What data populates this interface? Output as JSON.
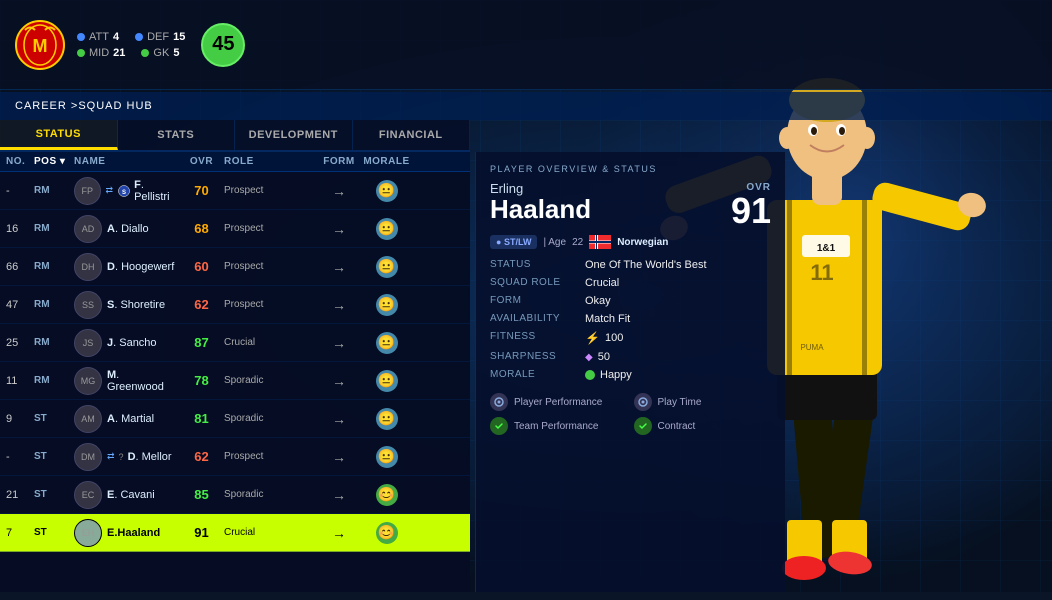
{
  "header": {
    "club": "Manchester United",
    "stats": {
      "att": {
        "label": "ATT",
        "value": "4",
        "color": "blue"
      },
      "def": {
        "label": "DEF",
        "value": "15",
        "color": "blue"
      },
      "mid": {
        "label": "MID",
        "value": "21",
        "color": "green"
      },
      "gk": {
        "label": "GK",
        "value": "5",
        "color": "green"
      }
    },
    "overall": "45"
  },
  "breadcrumb": {
    "prefix": "CAREER > ",
    "current": "SQUAD HUB"
  },
  "tabs": [
    {
      "id": "status",
      "label": "STATUS",
      "active": true
    },
    {
      "id": "stats",
      "label": "STATS",
      "active": false
    },
    {
      "id": "development",
      "label": "DEVELOPMENT",
      "active": false
    },
    {
      "id": "financial",
      "label": "FINANCIAL",
      "active": false
    }
  ],
  "table": {
    "columns": [
      "No.",
      "Pos",
      "Name",
      "OVR",
      "Role",
      "Form",
      "Morale"
    ],
    "rows": [
      {
        "no": "-",
        "pos": "RM",
        "name": "F. Pellistri",
        "bold": "F",
        "ovr": 70,
        "ovrColor": "orange",
        "role": "Prospect",
        "form": "→",
        "morale": "neutral",
        "selected": false,
        "hasTransfer": true,
        "hasClub": true
      },
      {
        "no": "16",
        "pos": "RM",
        "name": "A. Diallo",
        "bold": "A",
        "ovr": 68,
        "ovrColor": "orange",
        "role": "Prospect",
        "form": "→",
        "morale": "neutral",
        "selected": false,
        "hasTransfer": false,
        "hasClub": false
      },
      {
        "no": "66",
        "pos": "RM",
        "name": "D. Hoogewerf",
        "bold": "D",
        "ovr": 60,
        "ovrColor": "red",
        "role": "Prospect",
        "form": "→",
        "morale": "neutral",
        "selected": false,
        "hasTransfer": false,
        "hasClub": false
      },
      {
        "no": "47",
        "pos": "RM",
        "name": "S. Shoretire",
        "bold": "S",
        "ovr": 62,
        "ovrColor": "red",
        "role": "Prospect",
        "form": "→",
        "morale": "neutral",
        "selected": false,
        "hasTransfer": false,
        "hasClub": false
      },
      {
        "no": "25",
        "pos": "RM",
        "name": "J. Sancho",
        "bold": "J",
        "ovr": 87,
        "ovrColor": "green",
        "role": "Crucial",
        "form": "→",
        "morale": "neutral",
        "selected": false,
        "hasTransfer": false,
        "hasClub": false
      },
      {
        "no": "11",
        "pos": "RM",
        "name": "M. Greenwood",
        "bold": "M",
        "ovr": 78,
        "ovrColor": "green",
        "role": "Sporadic",
        "form": "→",
        "morale": "neutral",
        "selected": false,
        "hasTransfer": false,
        "hasClub": false
      },
      {
        "no": "9",
        "pos": "ST",
        "name": "A. Martial",
        "bold": "A",
        "ovr": 81,
        "ovrColor": "green",
        "role": "Sporadic",
        "form": "→",
        "morale": "neutral",
        "selected": false,
        "hasTransfer": false,
        "hasClub": false
      },
      {
        "no": "-",
        "pos": "ST",
        "name": "D. Mellor",
        "bold": "D",
        "ovr": 62,
        "ovrColor": "red",
        "role": "Prospect",
        "form": "→",
        "morale": "neutral",
        "selected": false,
        "hasTransfer": true,
        "hasLoan": true
      },
      {
        "no": "21",
        "pos": "ST",
        "name": "E. Cavani",
        "bold": "E",
        "ovr": 85,
        "ovrColor": "green",
        "role": "Sporadic",
        "form": "→",
        "morale": "happy",
        "selected": false,
        "hasTransfer": false,
        "hasClub": false
      },
      {
        "no": "7",
        "pos": "ST",
        "name": "E.Haaland",
        "bold": "E.H",
        "ovr": 91,
        "ovrColor": "green",
        "role": "Crucial",
        "form": "→",
        "morale": "happy",
        "selected": true,
        "hasTransfer": false,
        "hasClub": false
      }
    ]
  },
  "playerOverview": {
    "title": "PLAYER OVERVIEW & STATUS",
    "firstName": "Erling",
    "lastName": "Haaland",
    "position": "ST/LW",
    "age": 22,
    "nationality": "Norwegian",
    "ovrLabel": "OVR",
    "ovrValue": "91",
    "stats": [
      {
        "label": "STATUS",
        "value": "One Of The World's Best"
      },
      {
        "label": "SQUAD ROLE",
        "value": "Crucial"
      },
      {
        "label": "FORM",
        "value": "Okay"
      },
      {
        "label": "AVAILABILITY",
        "value": "Match Fit"
      },
      {
        "label": "FITNESS",
        "value": "100",
        "type": "lightning"
      },
      {
        "label": "SHARPNESS",
        "value": "50",
        "type": "diamond"
      },
      {
        "label": "MORALE",
        "value": "Happy",
        "type": "green-dot"
      }
    ],
    "badges": [
      {
        "label": "Player Performance",
        "color": "gray"
      },
      {
        "label": "Play Time",
        "color": "gray"
      },
      {
        "label": "Team Performance",
        "color": "green"
      },
      {
        "label": "Contract",
        "color": "green"
      }
    ]
  }
}
